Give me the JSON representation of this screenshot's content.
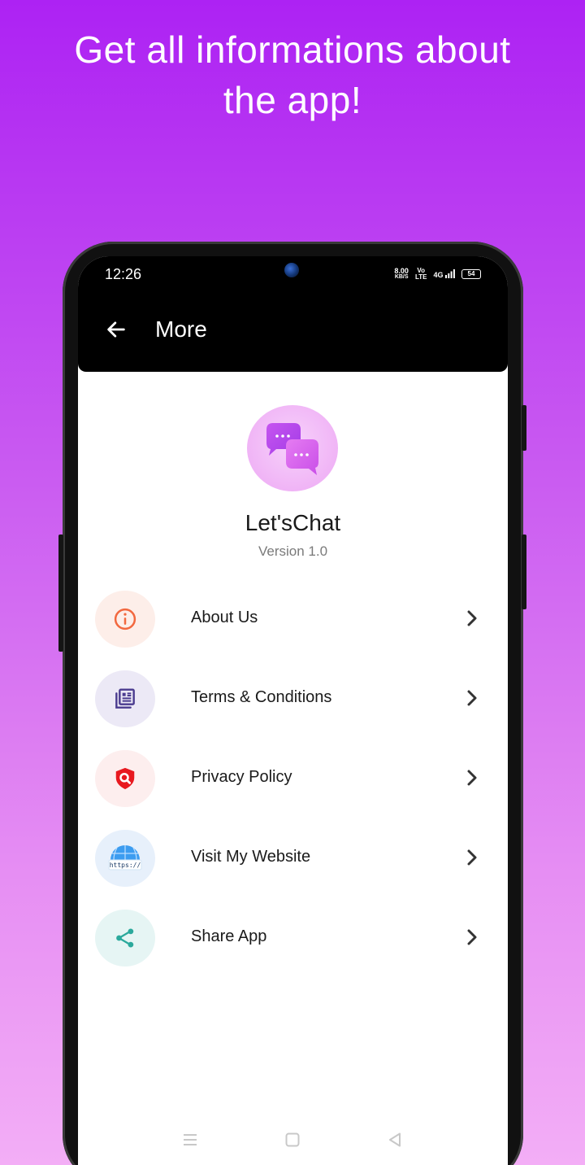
{
  "promo": {
    "headline_line1": "Get all informations about",
    "headline_line2": "the app!"
  },
  "status_bar": {
    "time": "12:26",
    "net_speed": "8.00",
    "net_speed_unit": "KB/S",
    "volte_top": "Vo",
    "volte_bottom": "LTE",
    "network": "4G",
    "battery": "54"
  },
  "appbar": {
    "back_icon": "arrow-left-icon",
    "title": "More"
  },
  "app_info": {
    "logo_icon": "chat-bubbles-icon",
    "name": "Let'sChat",
    "version": "Version 1.0"
  },
  "menu": {
    "items": [
      {
        "label": "About Us",
        "icon": "info-icon",
        "bg": "#fdeee9",
        "color": "#f2683f"
      },
      {
        "label": "Terms & Conditions",
        "icon": "document-stack-icon",
        "bg": "#ece9f6",
        "color": "#4a3b8f"
      },
      {
        "label": "Privacy Policy",
        "icon": "shield-search-icon",
        "bg": "#fdeeee",
        "color": "#e8191f"
      },
      {
        "label": "Visit My Website",
        "icon": "globe-https-icon",
        "bg": "#e7f0fb",
        "color": "#2f8fe8"
      },
      {
        "label": "Share App",
        "icon": "share-icon",
        "bg": "#e6f5f4",
        "color": "#2ba99c"
      }
    ],
    "chevron_icon": "chevron-right-icon"
  },
  "nav": {
    "menu_icon": "menu-lines-icon",
    "home_icon": "square-home-icon",
    "back_icon": "triangle-back-icon"
  }
}
